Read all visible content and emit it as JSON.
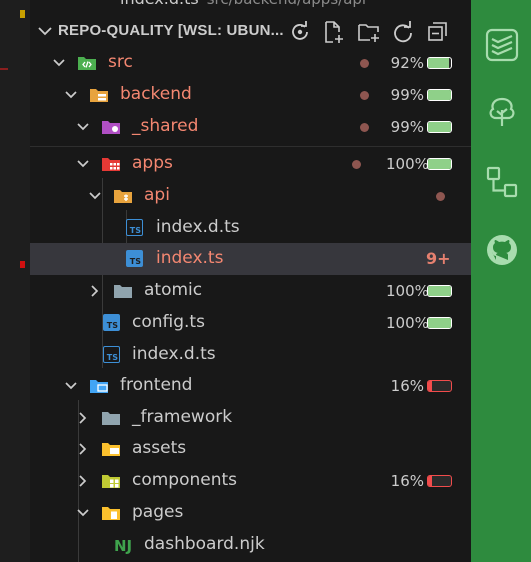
{
  "explorer": {
    "tab_peek": {
      "filename": "index.d.ts",
      "path": "src/backend/apps/api"
    },
    "header": {
      "title": "REPO-QUALITY [WSL: UBUN..."
    },
    "tree": [
      {
        "label": "src",
        "label_color": "#f48771",
        "percent": "92%",
        "coverage": 0.92,
        "bar_color": "#8fd089",
        "modified": true
      },
      {
        "label": "backend",
        "label_color": "#f48771",
        "percent": "99%",
        "coverage": 0.99,
        "bar_color": "#8fd089",
        "modified": true
      },
      {
        "label": "_shared",
        "label_color": "#f48771",
        "percent": "99%",
        "coverage": 0.99,
        "bar_color": "#8fd089",
        "modified": true
      },
      {
        "label": "apps",
        "label_color": "#f48771",
        "percent": "100%",
        "coverage": 1.0,
        "bar_color": "#8fd089",
        "modified": true
      },
      {
        "label": "api",
        "label_color": "#f48771",
        "modified": true
      },
      {
        "label": "index.d.ts",
        "label_color": "#cccccc",
        "icon": "typescript-icon"
      },
      {
        "label": "index.ts",
        "label_color": "#f48771",
        "icon": "typescript-icon",
        "problems": "9+",
        "selected": true
      },
      {
        "label": "atomic",
        "label_color": "#cccccc",
        "percent": "100%",
        "coverage": 1.0,
        "bar_color": "#8fd089"
      },
      {
        "label": "config.ts",
        "label_color": "#cccccc",
        "icon": "typescript-icon",
        "percent": "100%",
        "coverage": 1.0,
        "bar_color": "#8fd089"
      },
      {
        "label": "index.d.ts",
        "label_color": "#cccccc",
        "icon": "typescript-icon"
      },
      {
        "label": "frontend",
        "label_color": "#cccccc",
        "percent": "16%",
        "coverage": 0.16,
        "bar_color": "#f14c4c"
      },
      {
        "label": "_framework",
        "label_color": "#cccccc"
      },
      {
        "label": "assets",
        "label_color": "#cccccc"
      },
      {
        "label": "components",
        "label_color": "#cccccc",
        "percent": "16%",
        "coverage": 0.16,
        "bar_color": "#f14c4c"
      },
      {
        "label": "pages",
        "label_color": "#cccccc"
      },
      {
        "label": "dashboard.njk",
        "label_color": "#cccccc",
        "icon": "nunjucks-icon"
      }
    ]
  },
  "activity_bar": {
    "icons": [
      "todoist-icon",
      "tree-icon",
      "diagram-icon",
      "github-icon"
    ],
    "background": "#2e8b3e"
  }
}
